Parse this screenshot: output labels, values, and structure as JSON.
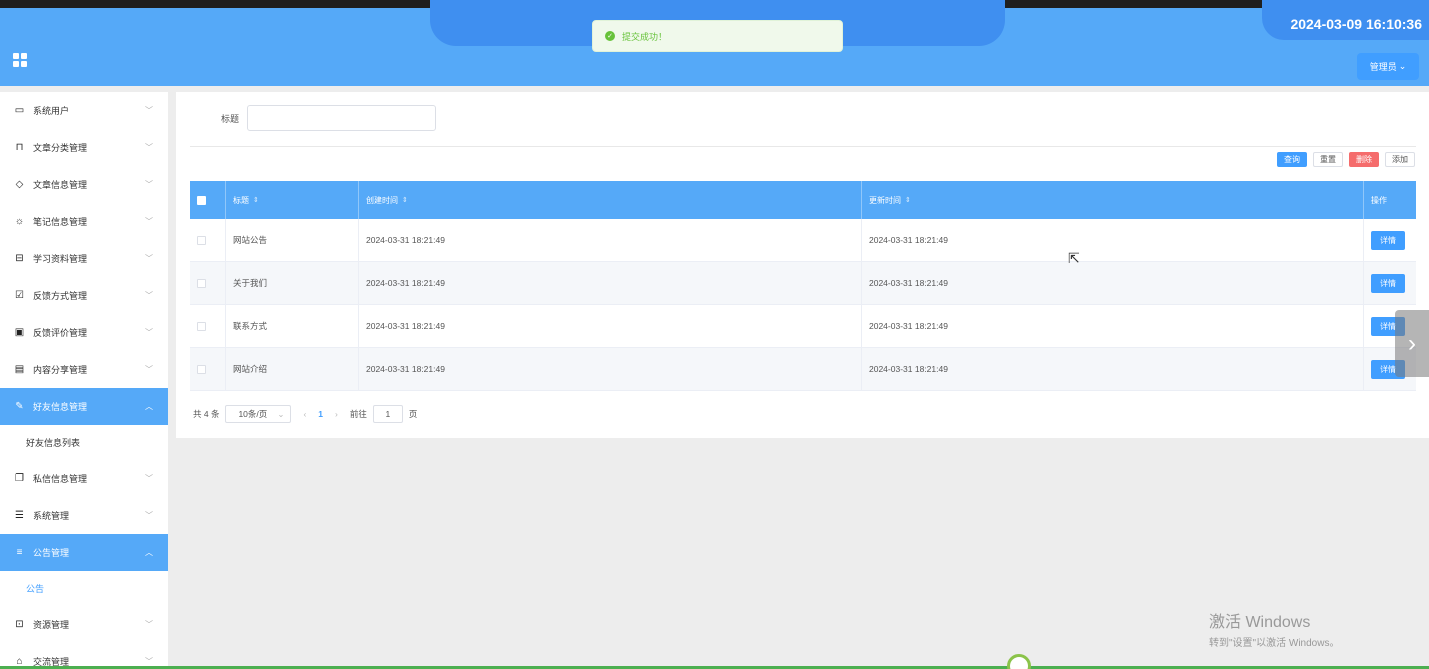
{
  "header": {
    "datetime": "2024-03-09 16:10:36",
    "user_button": "管理员",
    "toast_message": "提交成功！"
  },
  "sidebar": {
    "items": [
      {
        "label": "系统用户",
        "icon": "monitor-icon"
      },
      {
        "label": "文章分类管理",
        "icon": "bookmark-icon"
      },
      {
        "label": "文章信息管理",
        "icon": "tag-icon"
      },
      {
        "label": "笔记信息管理",
        "icon": "sun-icon"
      },
      {
        "label": "学习资料管理",
        "icon": "inbox-icon"
      },
      {
        "label": "反馈方式管理",
        "icon": "checklist-icon"
      },
      {
        "label": "反馈评价管理",
        "icon": "chat-icon"
      },
      {
        "label": "内容分享管理",
        "icon": "window-icon"
      },
      {
        "label": "好友信息管理",
        "icon": "paperclip-icon",
        "active": true,
        "sub": "好友信息列表"
      },
      {
        "label": "私信信息管理",
        "icon": "copy-icon"
      },
      {
        "label": "系统管理",
        "icon": "sliders-icon"
      },
      {
        "label": "公告管理",
        "icon": "list-icon",
        "active": true,
        "sub": "公告"
      },
      {
        "label": "资源管理",
        "icon": "lock-icon"
      },
      {
        "label": "交流管理",
        "icon": "pin-icon"
      }
    ]
  },
  "search": {
    "label": "标题"
  },
  "toolbar": {
    "query": "查询",
    "reset": "重置",
    "delete": "删除",
    "add": "添加"
  },
  "table": {
    "headers": [
      "标题",
      "创建时间",
      "更新时间",
      "操作"
    ],
    "rows": [
      {
        "title": "网站公告",
        "created": "2024-03-31 18:21:49",
        "updated": "2024-03-31 18:21:49",
        "action": "详情"
      },
      {
        "title": "关于我们",
        "created": "2024-03-31 18:21:49",
        "updated": "2024-03-31 18:21:49",
        "action": "详情"
      },
      {
        "title": "联系方式",
        "created": "2024-03-31 18:21:49",
        "updated": "2024-03-31 18:21:49",
        "action": "详情"
      },
      {
        "title": "网站介绍",
        "created": "2024-03-31 18:21:49",
        "updated": "2024-03-31 18:21:49",
        "action": "详情"
      }
    ]
  },
  "pagination": {
    "total": "共 4 条",
    "page_size": "10条/页",
    "current": "1",
    "goto_label": "前往",
    "goto_value": "1",
    "page_suffix": "页"
  },
  "watermark": {
    "line1": "激活 Windows",
    "line2": "转到\"设置\"以激活 Windows。"
  },
  "colors": {
    "header": "#55a9f8",
    "primary": "#409eff",
    "danger": "#f56c6c",
    "success": "#67c23a"
  }
}
